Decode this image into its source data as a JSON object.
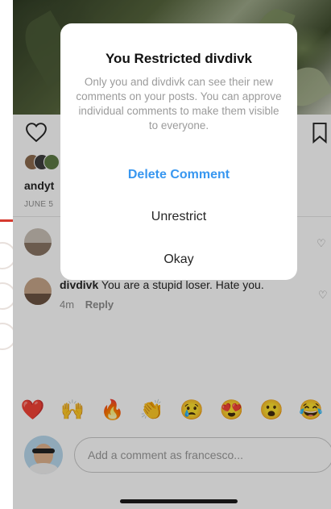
{
  "post": {
    "liked_by_user": "andyt",
    "date": "JUNE 5"
  },
  "comments": [
    {
      "username": "divdivk",
      "text": "You are a stupid loser. Hate you.",
      "time": "4m",
      "reply_label": "Reply"
    }
  ],
  "reactions": [
    "❤️",
    "🙌",
    "🔥",
    "👏",
    "😢",
    "😍",
    "😮",
    "😂"
  ],
  "compose": {
    "placeholder": "Add a comment as francesco..."
  },
  "modal": {
    "title": "You Restricted divdivk",
    "body": "Only you and divdivk can see their new comments on your posts. You can approve individual comments to make them visible to everyone.",
    "delete_label": "Delete Comment",
    "unrestrict_label": "Unrestrict",
    "okay_label": "Okay"
  },
  "colors": {
    "accent_blue": "#3897f0",
    "margin_red": "#d63a2f"
  },
  "icons": [
    "heart-icon",
    "bookmark-icon",
    "small-heart-icon"
  ]
}
